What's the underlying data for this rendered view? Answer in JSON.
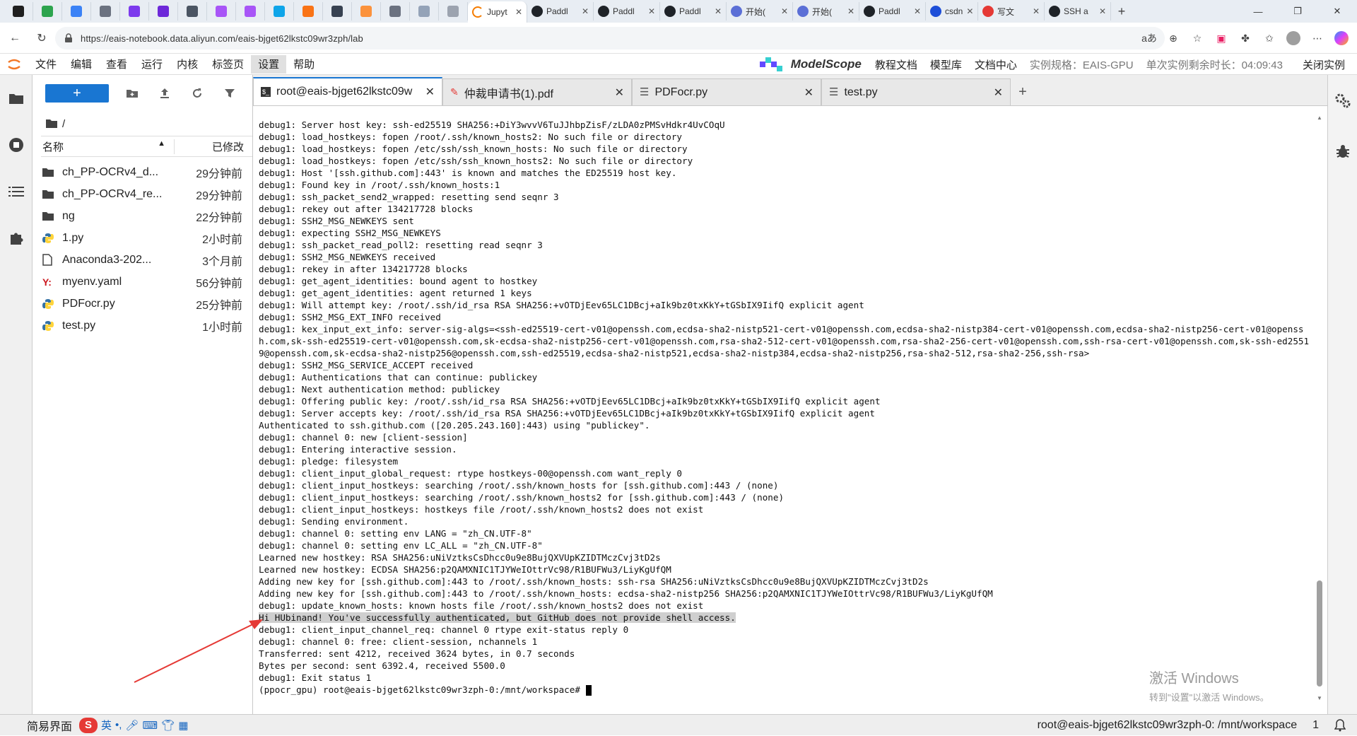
{
  "browser": {
    "tabs": [
      {
        "label": "",
        "color": "#1f1f1f"
      },
      {
        "label": "",
        "color": "#2da44e"
      },
      {
        "label": "",
        "color": "#3b82f6"
      },
      {
        "label": "",
        "color": "#6b7280"
      },
      {
        "label": "",
        "color": "#7c3aed"
      },
      {
        "label": "",
        "color": "#6d28d9"
      },
      {
        "label": "",
        "color": "#4b5563"
      },
      {
        "label": "",
        "color": "#a855f7"
      },
      {
        "label": "",
        "color": "#a855f7"
      },
      {
        "label": "",
        "color": "#0ea5e9"
      },
      {
        "label": "",
        "color": "#f97316"
      },
      {
        "label": "",
        "color": "#374151"
      },
      {
        "label": "",
        "color": "#fb923c"
      },
      {
        "label": "",
        "color": "#6b7280"
      },
      {
        "label": "",
        "color": "#94a3b8"
      },
      {
        "label": "",
        "color": "#9ca3af"
      }
    ],
    "active_tab": "Jupyt",
    "right_tabs": [
      {
        "label": "Paddl",
        "color": "#1f2328"
      },
      {
        "label": "Paddl",
        "color": "#1f2328"
      },
      {
        "label": "Paddl",
        "color": "#1f2328"
      },
      {
        "label": "开始(",
        "color": "#5b6fd6"
      },
      {
        "label": "开始(",
        "color": "#5b6fd6"
      },
      {
        "label": "Paddl",
        "color": "#1f2328"
      },
      {
        "label": "csdn",
        "color": "#1d4ed8"
      },
      {
        "label": "写文",
        "color": "#e53935"
      },
      {
        "label": "SSH a",
        "color": "#1f2328"
      }
    ],
    "url": "https://eais-notebook.data.aliyun.com/eais-bjget62lkstc09wr3zph/lab",
    "aa": "aあ"
  },
  "menu": {
    "items": [
      "文件",
      "编辑",
      "查看",
      "运行",
      "内核",
      "标签页",
      "设置",
      "帮助"
    ],
    "selected": "设置",
    "brand": "ModelScope",
    "links": [
      "教程文档",
      "模型库",
      "文档中心"
    ],
    "instance_spec": "实例规格：EAIS-GPU",
    "remaining": "单次实例剩余时长：04:09:43",
    "close": "关闭实例"
  },
  "filebrowser": {
    "new_label": "+",
    "path": "/",
    "col_name": "名称",
    "col_modified": "已修改",
    "files": [
      {
        "name": "ch_PP-OCRv4_d...",
        "time": "29分钟前",
        "icon": "folder"
      },
      {
        "name": "ch_PP-OCRv4_re...",
        "time": "29分钟前",
        "icon": "folder"
      },
      {
        "name": "ng",
        "time": "22分钟前",
        "icon": "folder"
      },
      {
        "name": "1.py",
        "time": "2小时前",
        "icon": "python"
      },
      {
        "name": "Anaconda3-202...",
        "time": "3个月前",
        "icon": "file"
      },
      {
        "name": "myenv.yaml",
        "time": "56分钟前",
        "icon": "yaml"
      },
      {
        "name": "PDFocr.py",
        "time": "25分钟前",
        "icon": "python"
      },
      {
        "name": "test.py",
        "time": "1小时前",
        "icon": "python"
      }
    ]
  },
  "doctabs": [
    {
      "label": "root@eais-bjget62lkstc09w",
      "icon": "terminal",
      "active": true
    },
    {
      "label": "仲裁申请书(1).pdf",
      "icon": "pdf",
      "active": false
    },
    {
      "label": "PDFocr.py",
      "icon": "text",
      "active": false
    },
    {
      "label": "test.py",
      "icon": "text",
      "active": false
    }
  ],
  "terminal": {
    "lines": [
      "debug1: Server host key: ssh-ed25519 SHA256:+DiY3wvvV6TuJJhbpZisF/zLDA0zPMSvHdkr4UvCOqU",
      "debug1: load_hostkeys: fopen /root/.ssh/known_hosts2: No such file or directory",
      "debug1: load_hostkeys: fopen /etc/ssh/ssh_known_hosts: No such file or directory",
      "debug1: load_hostkeys: fopen /etc/ssh/ssh_known_hosts2: No such file or directory",
      "debug1: Host '[ssh.github.com]:443' is known and matches the ED25519 host key.",
      "debug1: Found key in /root/.ssh/known_hosts:1",
      "debug1: ssh_packet_send2_wrapped: resetting send seqnr 3",
      "debug1: rekey out after 134217728 blocks",
      "debug1: SSH2_MSG_NEWKEYS sent",
      "debug1: expecting SSH2_MSG_NEWKEYS",
      "debug1: ssh_packet_read_poll2: resetting read seqnr 3",
      "debug1: SSH2_MSG_NEWKEYS received",
      "debug1: rekey in after 134217728 blocks",
      "debug1: get_agent_identities: bound agent to hostkey",
      "debug1: get_agent_identities: agent returned 1 keys",
      "debug1: Will attempt key: /root/.ssh/id_rsa RSA SHA256:+vOTDjEev65LC1DBcj+aIk9bz0txKkY+tGSbIX9IifQ explicit agent",
      "debug1: SSH2_MSG_EXT_INFO received",
      "debug1: kex_input_ext_info: server-sig-algs=<ssh-ed25519-cert-v01@openssh.com,ecdsa-sha2-nistp521-cert-v01@openssh.com,ecdsa-sha2-nistp384-cert-v01@openssh.com,ecdsa-sha2-nistp256-cert-v01@openssh.com,sk-ssh-ed25519-cert-v01@openssh.com,sk-ecdsa-sha2-nistp256-cert-v01@openssh.com,rsa-sha2-512-cert-v01@openssh.com,rsa-sha2-256-cert-v01@openssh.com,ssh-rsa-cert-v01@openssh.com,sk-ssh-ed25519@openssh.com,sk-ecdsa-sha2-nistp256@openssh.com,ssh-ed25519,ecdsa-sha2-nistp521,ecdsa-sha2-nistp384,ecdsa-sha2-nistp256,rsa-sha2-512,rsa-sha2-256,ssh-rsa>",
      "debug1: SSH2_MSG_SERVICE_ACCEPT received",
      "debug1: Authentications that can continue: publickey",
      "debug1: Next authentication method: publickey",
      "debug1: Offering public key: /root/.ssh/id_rsa RSA SHA256:+vOTDjEev65LC1DBcj+aIk9bz0txKkY+tGSbIX9IifQ explicit agent",
      "debug1: Server accepts key: /root/.ssh/id_rsa RSA SHA256:+vOTDjEev65LC1DBcj+aIk9bz0txKkY+tGSbIX9IifQ explicit agent",
      "Authenticated to ssh.github.com ([20.205.243.160]:443) using \"publickey\".",
      "debug1: channel 0: new [client-session]",
      "debug1: Entering interactive session.",
      "debug1: pledge: filesystem",
      "debug1: client_input_global_request: rtype hostkeys-00@openssh.com want_reply 0",
      "debug1: client_input_hostkeys: searching /root/.ssh/known_hosts for [ssh.github.com]:443 / (none)",
      "debug1: client_input_hostkeys: searching /root/.ssh/known_hosts2 for [ssh.github.com]:443 / (none)",
      "debug1: client_input_hostkeys: hostkeys file /root/.ssh/known_hosts2 does not exist",
      "debug1: Sending environment.",
      "debug1: channel 0: setting env LANG = \"zh_CN.UTF-8\"",
      "debug1: channel 0: setting env LC_ALL = \"zh_CN.UTF-8\"",
      "Learned new hostkey: RSA SHA256:uNiVztksCsDhcc0u9e8BujQXVUpKZIDTMczCvj3tD2s",
      "Learned new hostkey: ECDSA SHA256:p2QAMXNIC1TJYWeIOttrVc98/R1BUFWu3/LiyKgUfQM",
      "Adding new key for [ssh.github.com]:443 to /root/.ssh/known_hosts: ssh-rsa SHA256:uNiVztksCsDhcc0u9e8BujQXVUpKZIDTMczCvj3tD2s",
      "Adding new key for [ssh.github.com]:443 to /root/.ssh/known_hosts: ecdsa-sha2-nistp256 SHA256:p2QAMXNIC1TJYWeIOttrVc98/R1BUFWu3/LiyKgUfQM",
      "debug1: update_known_hosts: known hosts file /root/.ssh/known_hosts2 does not exist",
      "Hi HUbinand! You've successfully authenticated, but GitHub does not provide shell access.",
      "debug1: client_input_channel_req: channel 0 rtype exit-status reply 0",
      "debug1: channel 0: free: client-session, nchannels 1",
      "Transferred: sent 4212, received 3624 bytes, in 0.7 seconds",
      "Bytes per second: sent 6392.4, received 5500.0",
      "debug1: Exit status 1",
      "(ppocr_gpu) root@eais-bjget62lkstc09wr3zph-0:/mnt/workspace# "
    ],
    "highlight_index": 39
  },
  "watermark": {
    "line1": "激活 Windows",
    "line2": "转到\"设置\"以激活 Windows。"
  },
  "statusbar": {
    "mode": "简易界面",
    "ime_logo": "S",
    "ime_lang": "英",
    "path": "root@eais-bjget62lkstc09wr3zph-0: /mnt/workspace",
    "count": "1"
  }
}
